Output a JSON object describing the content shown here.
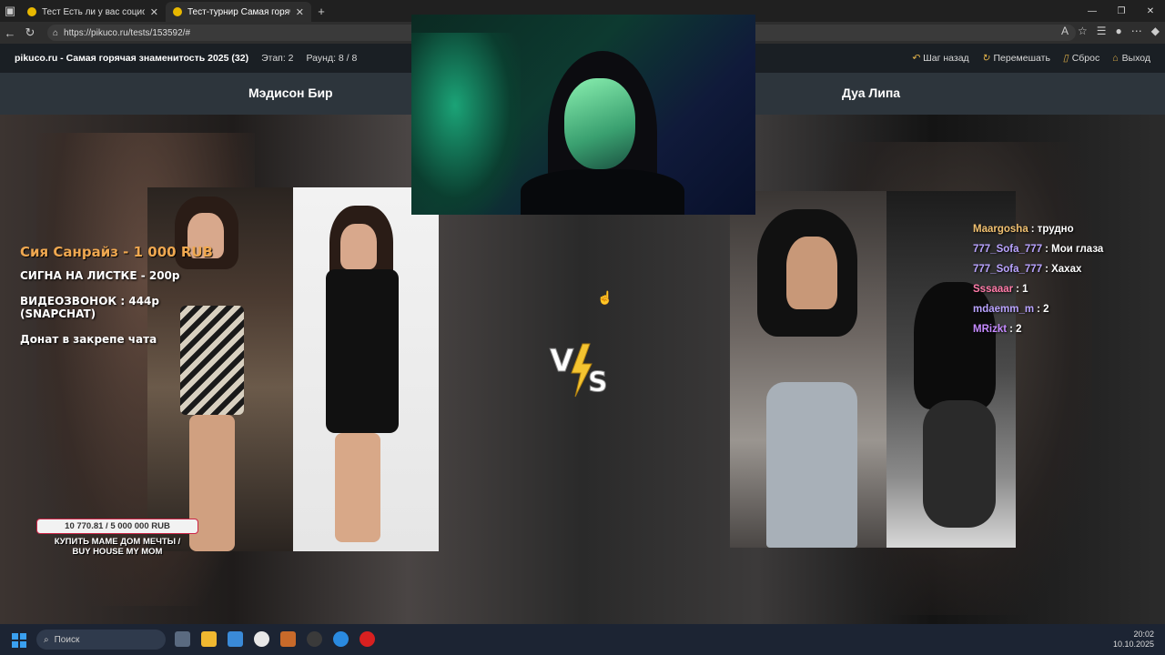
{
  "browser": {
    "tabs": [
      {
        "label": "Тест Есть ли у вас социофобия?",
        "active": false
      },
      {
        "label": "Тест-турнир Самая горячая знам",
        "active": true
      }
    ],
    "url": "https://pikuco.ru/tests/153592/#"
  },
  "site": {
    "title": "pikuco.ru - Самая горячая знаменитость 2025 (32)",
    "stage": "Этап: 2",
    "round": "Раунд: 8 / 8",
    "actions": {
      "back": "Шаг назад",
      "shuffle": "Перемешать",
      "reset": "Сброс",
      "exit": "Выход"
    }
  },
  "matchup": {
    "left_name": "Мэдисон Бир",
    "right_name": "Дуа Липа",
    "vs_label": "VS"
  },
  "stream_overlay": {
    "donation_top": "Сия Санрайз - 1 000 RUB",
    "lines": [
      "СИГНА  НА ЛИСТКЕ - 200р",
      "ВИДЕОЗВОНОК  : 444р",
      "(SNAPCHAT)",
      "Донат в закрепе чата"
    ],
    "goal_progress": "10 770.81 / 5 000 000 RUB",
    "goal_text_1": "КУПИТЬ МАМЕ ДОМ МЕЧТЫ /",
    "goal_text_2": "BUY HOUSE MY MOM"
  },
  "chat": [
    {
      "user": "Maargosha",
      "message": ": трудно",
      "color": "#f0c070"
    },
    {
      "user": "777_Sofa_777",
      "message": ": Мои глаза",
      "color": "#b9a3ff"
    },
    {
      "user": "777_Sofa_777",
      "message": ": Хахах",
      "color": "#b9a3ff"
    },
    {
      "user": "Sssaaar",
      "message": ": 1",
      "color": "#ff7aa8"
    },
    {
      "user": "mdaemm_m",
      "message": ": 2",
      "color": "#b9a3ff"
    },
    {
      "user": "MRizkt",
      "message": ": 2",
      "color": "#c58aff"
    }
  ],
  "taskbar": {
    "search_placeholder": "Поиск",
    "time": "20:02",
    "date": "10.10.2025"
  }
}
